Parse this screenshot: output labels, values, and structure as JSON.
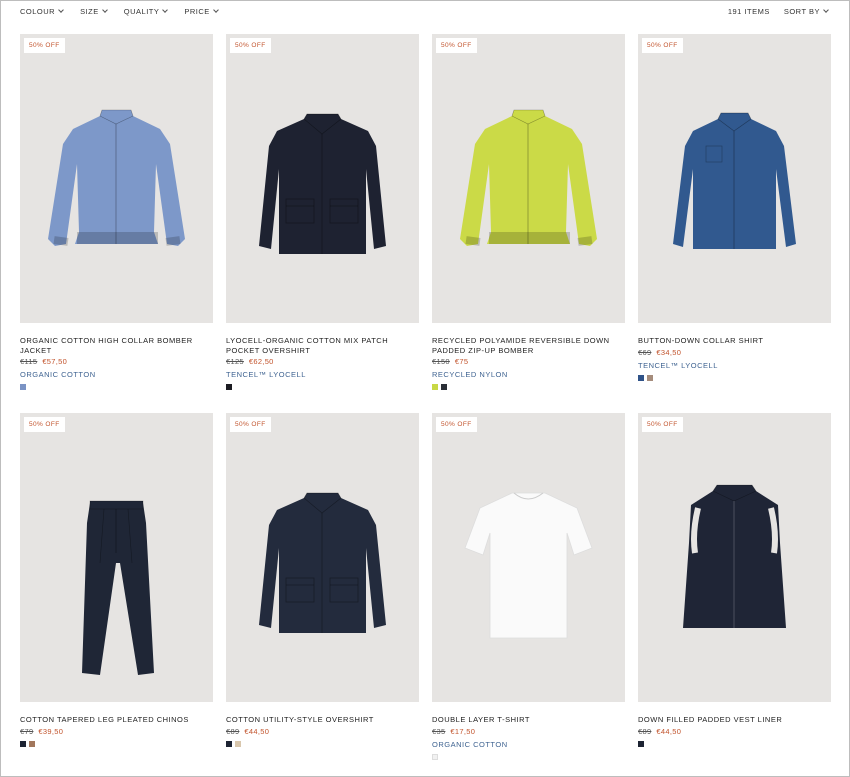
{
  "filters": [
    {
      "label": "COLOUR"
    },
    {
      "label": "SIZE"
    },
    {
      "label": "QUALITY"
    },
    {
      "label": "PRICE"
    }
  ],
  "items_count": "191 ITEMS",
  "sort_label": "SORT BY",
  "products": [
    {
      "badge": "50% OFF",
      "name": "ORGANIC COTTON HIGH COLLAR BOMBER JACKET",
      "old_price": "€115",
      "new_price": "€57,50",
      "material": "ORGANIC COTTON",
      "swatches": [
        "#7a93c4"
      ],
      "garment": "bomber",
      "garment_color": "#7d98c9"
    },
    {
      "badge": "50% OFF",
      "name": "LYOCELL-ORGANIC COTTON MIX PATCH POCKET OVERSHIRT",
      "old_price": "€125",
      "new_price": "€62,50",
      "material": "TENCEL™ LYOCELL",
      "swatches": [
        "#1c1c22"
      ],
      "garment": "overshirt",
      "garment_color": "#1e2231"
    },
    {
      "badge": "50% OFF",
      "name": "RECYCLED POLYAMIDE REVERSIBLE DOWN PADDED ZIP-UP BOMBER",
      "old_price": "€150",
      "new_price": "€75",
      "material": "RECYCLED NYLON",
      "swatches": [
        "#c8d845",
        "#2b2f36"
      ],
      "garment": "bomber",
      "garment_color": "#cbda47"
    },
    {
      "badge": "50% OFF",
      "name": "BUTTON-DOWN COLLAR SHIRT",
      "old_price": "€69",
      "new_price": "€34,50",
      "material": "TENCEL™ LYOCELL",
      "swatches": [
        "#2f5288",
        "#a58c7c"
      ],
      "garment": "shirt",
      "garment_color": "#31598f"
    },
    {
      "badge": "50% OFF",
      "name": "COTTON TAPERED LEG PLEATED CHINOS",
      "old_price": "€79",
      "new_price": "€39,50",
      "material": "",
      "swatches": [
        "#1d2433",
        "#a2775c"
      ],
      "garment": "trousers",
      "garment_color": "#1f2636"
    },
    {
      "badge": "50% OFF",
      "name": "COTTON UTILITY-STYLE OVERSHIRT",
      "old_price": "€89",
      "new_price": "€44,50",
      "material": "",
      "swatches": [
        "#1d2433",
        "#d9c7ad"
      ],
      "garment": "overshirt",
      "garment_color": "#232b3d"
    },
    {
      "badge": "50% OFF",
      "name": "DOUBLE LAYER T-SHIRT",
      "old_price": "€35",
      "new_price": "€17,50",
      "material": "ORGANIC COTTON",
      "swatches": [
        "#f1f1f1"
      ],
      "garment": "tshirt",
      "garment_color": "#fafafa"
    },
    {
      "badge": "50% OFF",
      "name": "DOWN FILLED PADDED VEST LINER",
      "old_price": "€89",
      "new_price": "€44,50",
      "material": "",
      "swatches": [
        "#1d2433"
      ],
      "garment": "vest",
      "garment_color": "#1f2536"
    }
  ]
}
